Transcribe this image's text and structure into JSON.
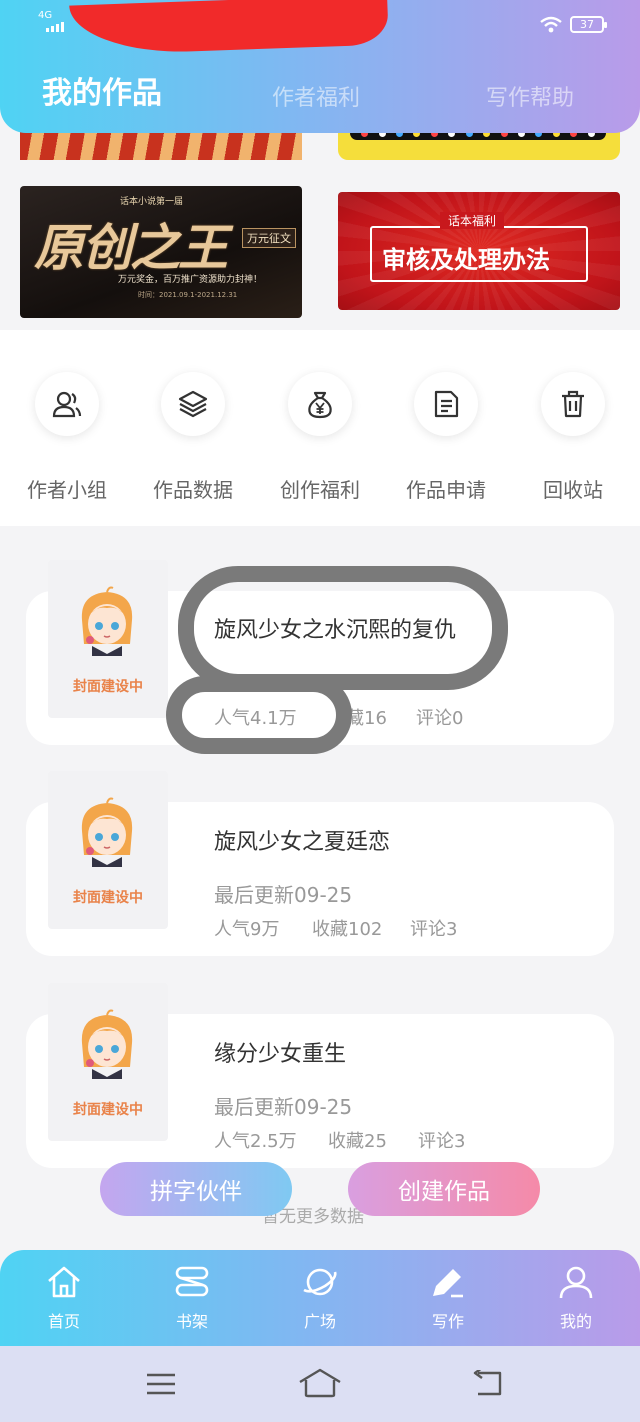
{
  "status_bar": {
    "network": "4G",
    "battery": "37"
  },
  "header": {
    "tabs": [
      {
        "label": "我的作品",
        "active": true
      },
      {
        "label": "作者福利",
        "active": false
      },
      {
        "label": "写作帮助",
        "active": false
      }
    ]
  },
  "banners": {
    "original": {
      "kicker": "话本小说第一届",
      "title": "原创之王",
      "tag": "万元征文",
      "subtitle": "万元奖金，百万推广资源助力封神！",
      "date": "时间：2021.09.1-2021.12.31"
    },
    "review": {
      "kicker": "话本福利",
      "title": "审核及处理办法"
    }
  },
  "menu": [
    {
      "label": "作者小组",
      "icon": "users-icon"
    },
    {
      "label": "作品数据",
      "icon": "layers-icon"
    },
    {
      "label": "创作福利",
      "icon": "money-bag-icon"
    },
    {
      "label": "作品申请",
      "icon": "document-icon"
    },
    {
      "label": "回收站",
      "icon": "trash-icon"
    }
  ],
  "works": [
    {
      "cover_text": "封面建设中",
      "title": "旋风少女之水沉熙的复仇",
      "popularity": "人气4.1万",
      "favorites": "藏16",
      "comments": "评论0"
    },
    {
      "cover_text": "封面建设中",
      "title": "旋风少女之夏廷恋",
      "updated": "最后更新09-25",
      "popularity": "人气9万",
      "favorites": "收藏102",
      "comments": "评论3"
    },
    {
      "cover_text": "封面建设中",
      "title": "缘分少女重生",
      "updated": "最后更新09-25",
      "popularity": "人气2.5万",
      "favorites": "收藏25",
      "comments": "评论3"
    }
  ],
  "actions": {
    "partner": "拼字伙伴",
    "create": "创建作品"
  },
  "footer_text": "暂无更多数据",
  "bottom_nav": [
    {
      "label": "首页",
      "icon": "home-icon"
    },
    {
      "label": "书架",
      "icon": "bookshelf-icon"
    },
    {
      "label": "广场",
      "icon": "planet-icon"
    },
    {
      "label": "写作",
      "icon": "pen-icon",
      "active": true
    },
    {
      "label": "我的",
      "icon": "profile-icon"
    }
  ],
  "colors": {
    "header_gradient_start": "#4fd3f3",
    "header_gradient_end": "#b99be9",
    "partner_button": "#c4a6ef",
    "create_button": "#f58aa8",
    "cover_text": "#e9834a"
  }
}
